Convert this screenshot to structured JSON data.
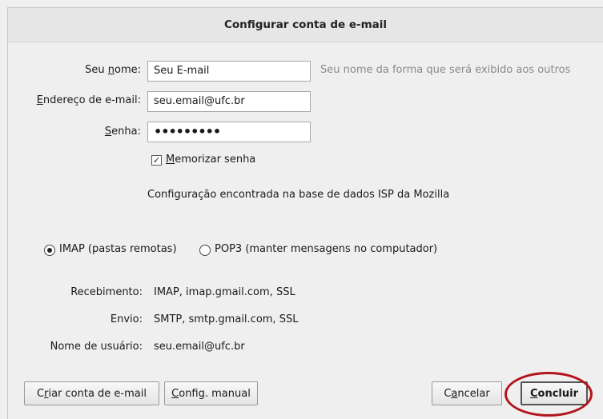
{
  "dialog": {
    "title": "Configurar conta de e-mail"
  },
  "form": {
    "name_label_pre": "Seu ",
    "name_label_u": "n",
    "name_label_post": "ome:",
    "name_value": "Seu E-mail",
    "name_hint": "Seu nome da forma que será exibido aos outros",
    "email_label_u": "E",
    "email_label_post": "ndereço de e-mail:",
    "email_value": "seu.email@ufc.br",
    "password_label_u": "S",
    "password_label_post": "enha:",
    "password_value": "•••••••••",
    "remember_checked": true,
    "remember_check_glyph": "✓",
    "remember_label_u": "M",
    "remember_label_post": "emorizar senha"
  },
  "status_message": "Configuração encontrada na base de dados ISP da Mozilla",
  "protocol": {
    "selected": "IMAP",
    "imap_label": "IMAP (pastas remotas)",
    "pop3_label": "POP3 (manter mensagens no computador)"
  },
  "summary": {
    "incoming_label": "Recebimento:",
    "incoming_value": "IMAP, imap.gmail.com, SSL",
    "outgoing_label": "Envio:",
    "outgoing_value": "SMTP, smtp.gmail.com, SSL",
    "username_label": "Nome de usuário:",
    "username_value": "seu.email@ufc.br"
  },
  "buttons": {
    "create_pre": "C",
    "create_u": "r",
    "create_post": "iar conta de e-mail",
    "manual_pre": "",
    "manual_u": "C",
    "manual_post": "onfig. manual",
    "cancel_pre": "C",
    "cancel_u": "a",
    "cancel_post": "ncelar",
    "done_u": "C",
    "done_post": "oncluir"
  },
  "colors": {
    "highlight_ring": "#b3141c"
  }
}
